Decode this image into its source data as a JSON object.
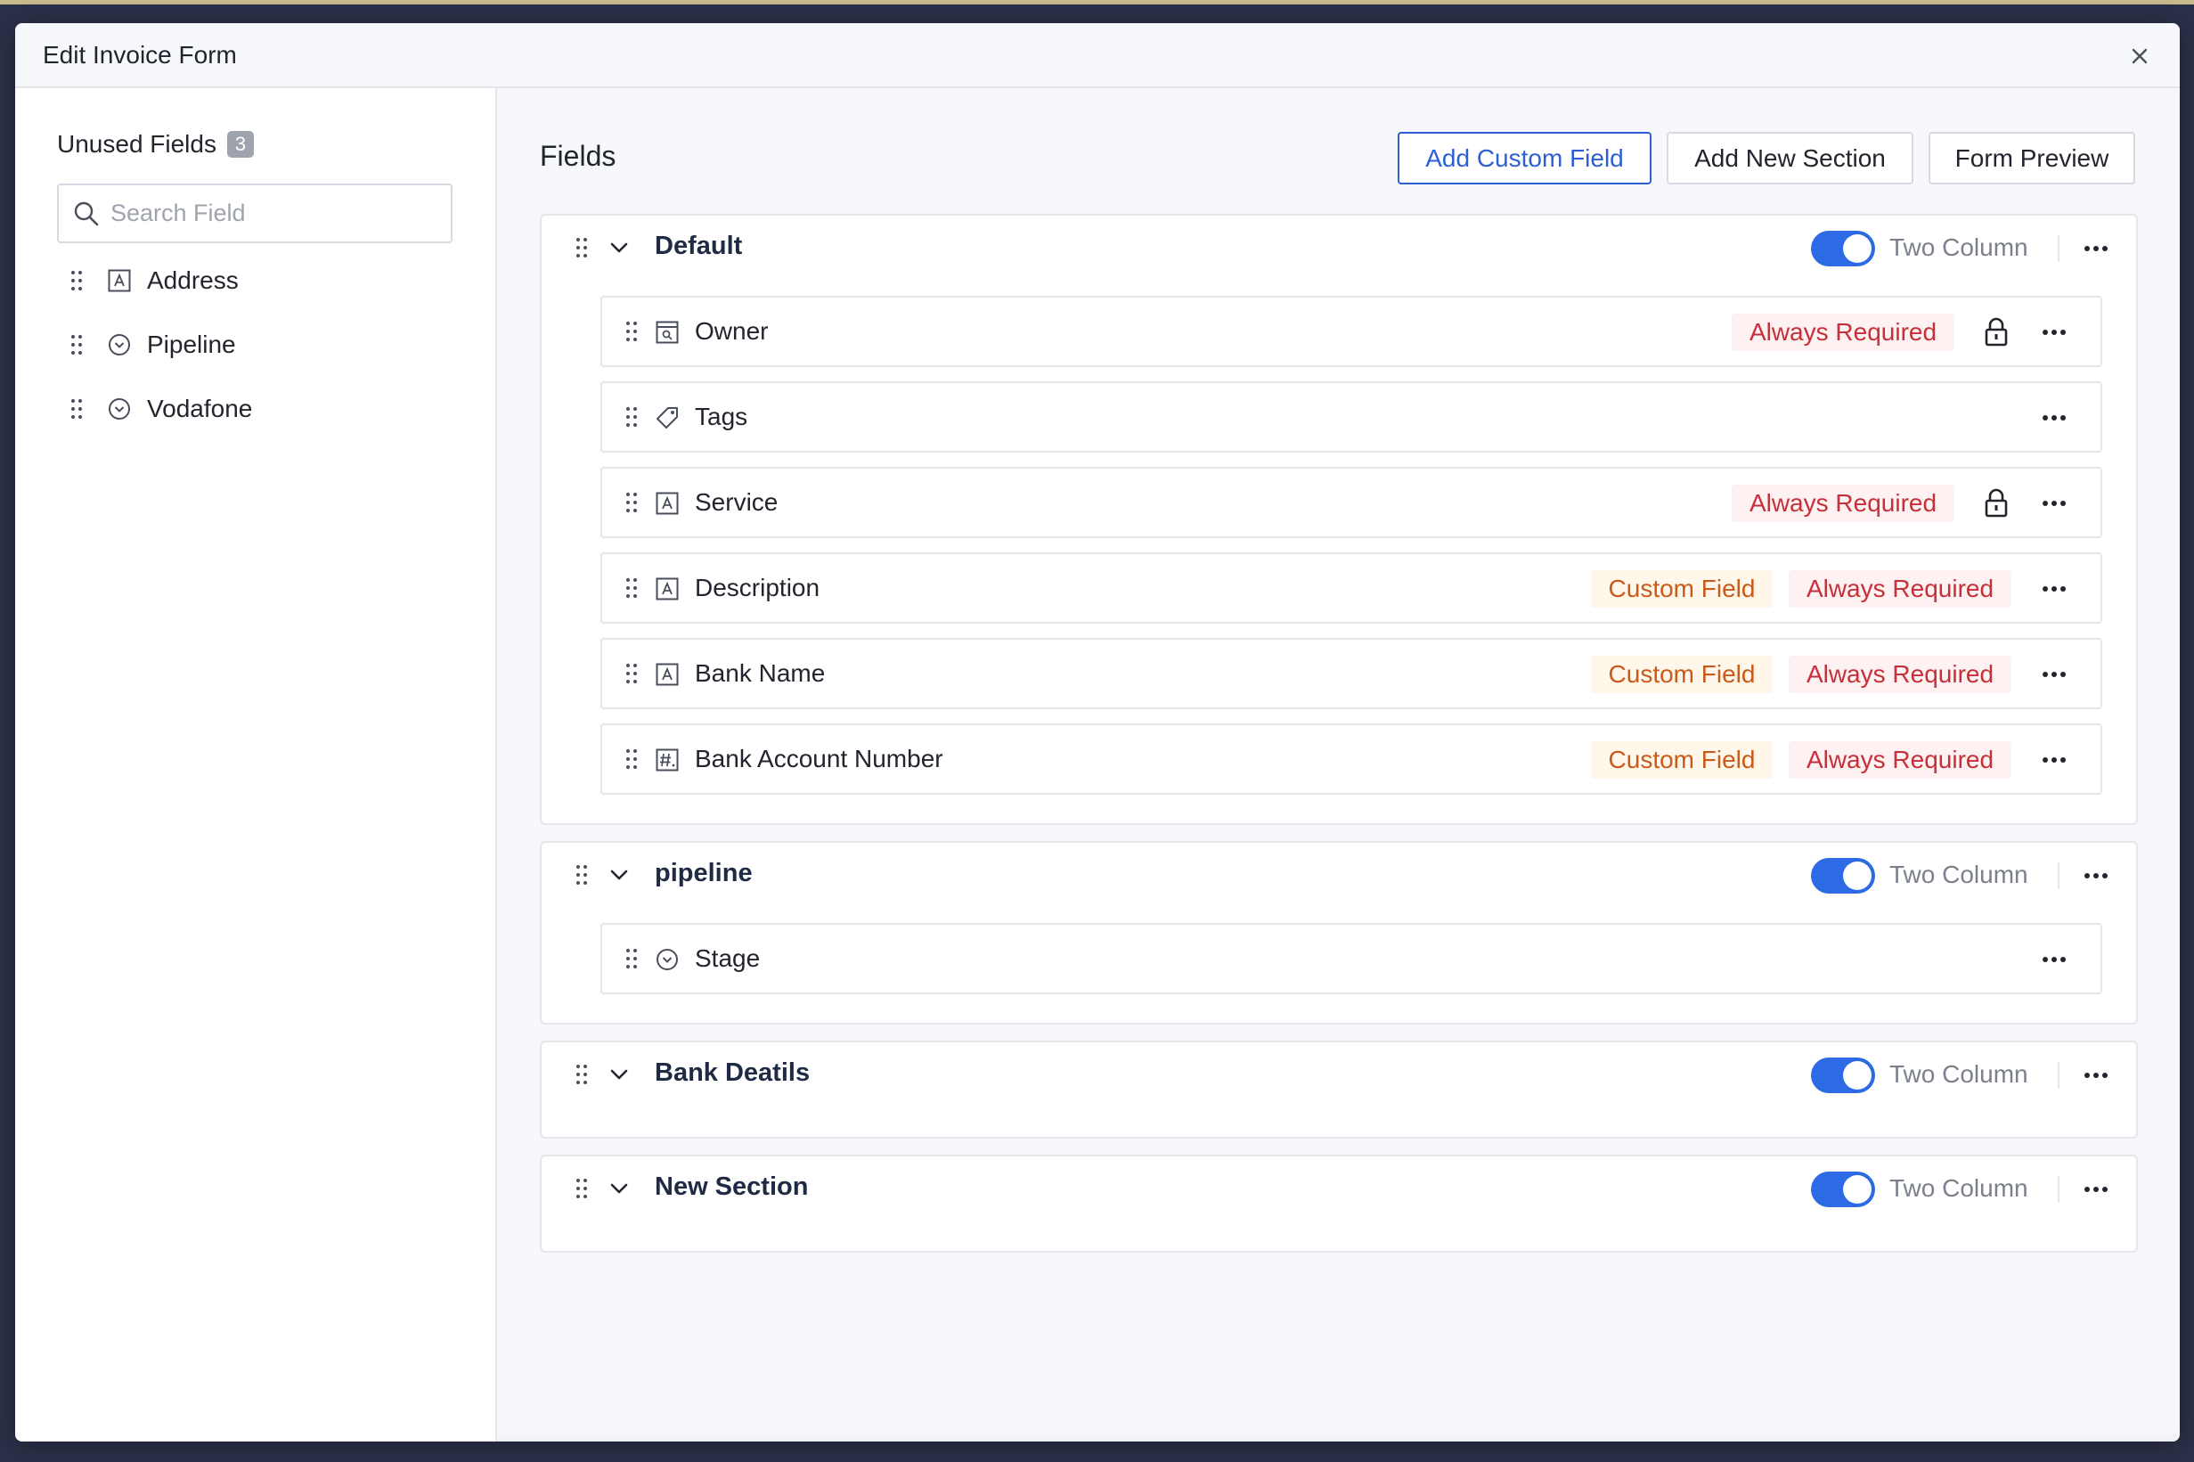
{
  "dialog": {
    "title": "Edit Invoice Form"
  },
  "sidebar": {
    "title": "Unused Fields",
    "count": "3",
    "search": {
      "placeholder": "Search Field",
      "value": ""
    },
    "items": [
      {
        "label": "Address",
        "icon": "text-field-icon"
      },
      {
        "label": "Pipeline",
        "icon": "dropdown-field-icon"
      },
      {
        "label": "Vodafone",
        "icon": "dropdown-field-icon"
      }
    ]
  },
  "main": {
    "title": "Fields",
    "buttons": {
      "add_custom": "Add Custom Field",
      "add_section": "Add New Section",
      "preview": "Form Preview"
    },
    "two_column_label": "Two Column",
    "tags": {
      "always_required": "Always Required",
      "custom_field": "Custom Field"
    },
    "sections": [
      {
        "title": "Default",
        "two_column": true,
        "fields": [
          {
            "label": "Owner",
            "icon": "lookup-field-icon",
            "custom": false,
            "required": true,
            "locked": true
          },
          {
            "label": "Tags",
            "icon": "tag-icon",
            "custom": false,
            "required": false,
            "locked": false
          },
          {
            "label": "Service",
            "icon": "text-field-icon",
            "custom": false,
            "required": true,
            "locked": true
          },
          {
            "label": "Description",
            "icon": "text-field-icon",
            "custom": true,
            "required": true,
            "locked": false
          },
          {
            "label": "Bank Name",
            "icon": "text-field-icon",
            "custom": true,
            "required": true,
            "locked": false
          },
          {
            "label": "Bank Account Number",
            "icon": "number-field-icon",
            "custom": true,
            "required": true,
            "locked": false
          }
        ]
      },
      {
        "title": "pipeline",
        "two_column": true,
        "fields": [
          {
            "label": "Stage",
            "icon": "dropdown-field-icon",
            "custom": false,
            "required": false,
            "locked": false
          }
        ]
      },
      {
        "title": "Bank Deatils",
        "two_column": true,
        "fields": []
      },
      {
        "title": "New Section",
        "two_column": true,
        "fields": []
      }
    ]
  },
  "colors": {
    "accent": "#2d6be4",
    "required_text": "#c6303a",
    "required_bg": "#fdf1f1",
    "custom_text": "#c85a1c",
    "custom_bg": "#fff7ea"
  }
}
